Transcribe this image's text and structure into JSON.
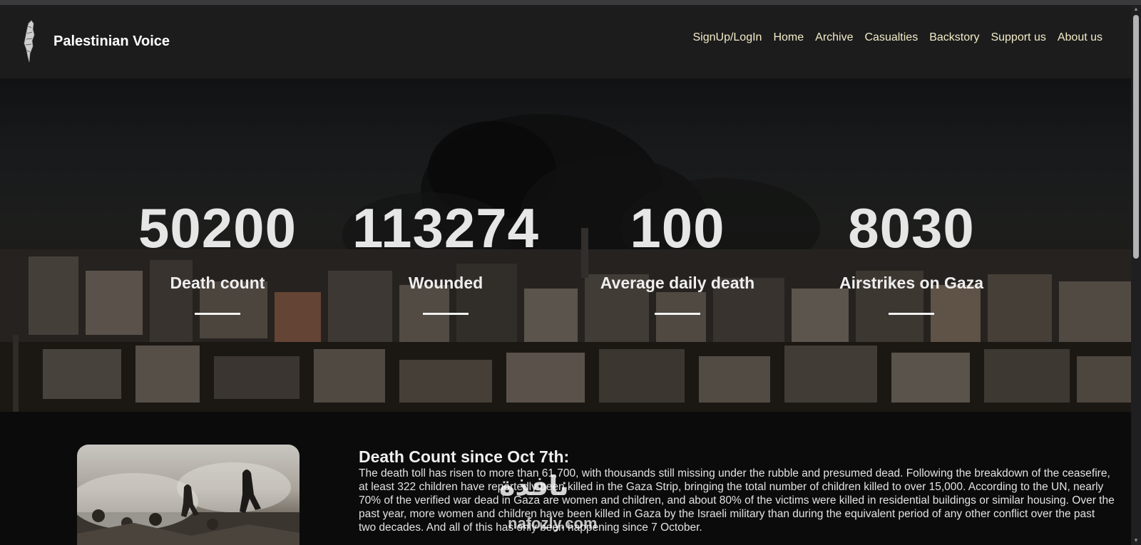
{
  "brand": {
    "name": "Palestinian Voice",
    "logo_icon": "palestine-map-icon"
  },
  "nav": {
    "items": [
      {
        "label": "SignUp/LogIn"
      },
      {
        "label": "Home"
      },
      {
        "label": "Archive"
      },
      {
        "label": "Casualties"
      },
      {
        "label": "Backstory"
      },
      {
        "label": "Support us"
      },
      {
        "label": "About us"
      }
    ]
  },
  "stats": [
    {
      "value": "50200",
      "label": "Death count"
    },
    {
      "value": "113274",
      "label": "Wounded"
    },
    {
      "value": "100",
      "label": "Average daily death"
    },
    {
      "value": "8030",
      "label": "Airstrikes on Gaza"
    }
  ],
  "article": {
    "title": "Death Count since Oct 7th:",
    "body": "The death toll has risen to more than 61,700, with thousands still missing under the rubble and presumed dead. Following the breakdown of the ceasefire, at least 322 children have reportedly been killed in the Gaza Strip, bringing the total number of children killed to over 15,000. According to the UN, nearly 70% of the verified war dead in Gaza are women and children, and about 80% of the victims were killed in residential buildings or similar housing. Over the past year, more women and children have been killed in Gaza by the Israeli military than during the equivalent period of any other conflict over the past two decades. And all of this has only been happening since 7 October."
  },
  "watermark": {
    "main": "نافذة",
    "sub": "nafozly.com"
  },
  "colors": {
    "nav_text": "#f3ecc8",
    "navbar_bg": "#1c1c1d",
    "page_bg": "#0b0b0c"
  }
}
